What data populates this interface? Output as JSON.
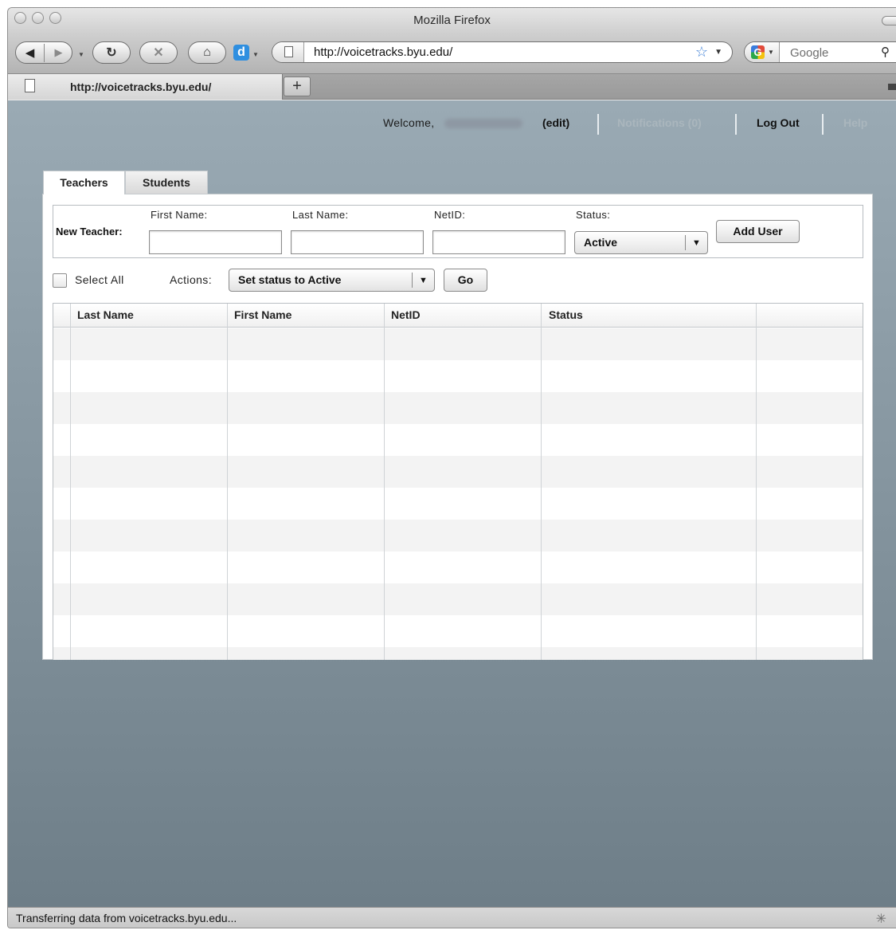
{
  "window": {
    "title": "Mozilla Firefox"
  },
  "toolbar": {
    "url": "http://voicetracks.byu.edu/",
    "search_placeholder": "Google"
  },
  "browser_tabs": [
    {
      "title": "http://voicetracks.byu.edu/"
    }
  ],
  "header": {
    "welcome": "Welcome,",
    "edit": "(edit)",
    "notifications": "Notifications (0)",
    "logout": "Log Out",
    "help": "Help"
  },
  "page_tabs": [
    {
      "label": "Teachers",
      "active": true
    },
    {
      "label": "Students",
      "active": false
    }
  ],
  "new_teacher": {
    "label": "New Teacher:",
    "first_name_label": "First Name:",
    "last_name_label": "Last Name:",
    "netid_label": "NetID:",
    "status_label": "Status:",
    "status_value": "Active",
    "add_button": "Add User"
  },
  "bulk": {
    "select_all": "Select All",
    "actions_label": "Actions:",
    "action_value": "Set status to Active",
    "go_button": "Go"
  },
  "table": {
    "columns": [
      "Last Name",
      "First Name",
      "NetID",
      "Status"
    ],
    "rows": []
  },
  "statusbar": {
    "text": "Transferring data from voicetracks.byu.edu..."
  }
}
